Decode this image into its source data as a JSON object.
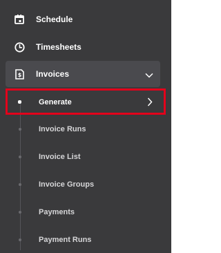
{
  "nav": {
    "schedule": {
      "label": "Schedule",
      "icon": "calendar-icon"
    },
    "timesheets": {
      "label": "Timesheets",
      "icon": "clock-icon"
    },
    "invoices": {
      "label": "Invoices",
      "icon": "invoice-doc-icon",
      "expanded": true
    }
  },
  "invoices_sub": [
    {
      "label": "Generate",
      "selected": true
    },
    {
      "label": "Invoice Runs"
    },
    {
      "label": "Invoice List"
    },
    {
      "label": "Invoice Groups"
    },
    {
      "label": "Payments"
    },
    {
      "label": "Payment Runs"
    }
  ],
  "colors": {
    "sidebar_bg": "#3a3a3c",
    "active_bg": "#4a4a4e",
    "highlight": "#e3001b"
  }
}
